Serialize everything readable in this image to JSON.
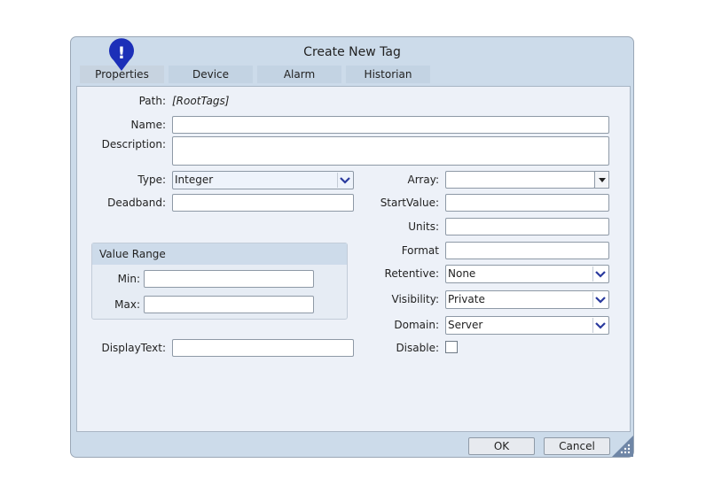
{
  "window": {
    "title": "Create New Tag"
  },
  "tabs": [
    "Properties",
    "Device",
    "Alarm",
    "Historian"
  ],
  "fields": {
    "path_label": "Path:",
    "path_value": "[RootTags]",
    "name_label": "Name:",
    "name_value": "",
    "description_label": "Description:",
    "description_value": "",
    "type_label": "Type:",
    "type_value": "Integer",
    "deadband_label": "Deadband:",
    "deadband_value": "",
    "array_label": "Array:",
    "array_value": "",
    "startvalue_label": "StartValue:",
    "startvalue_value": "",
    "units_label": "Units:",
    "units_value": "",
    "format_label": "Format",
    "format_value": "",
    "retentive_label": "Retentive:",
    "retentive_value": "None",
    "visibility_label": "Visibility:",
    "visibility_value": "Private",
    "domain_label": "Domain:",
    "domain_value": "Server",
    "disable_label": "Disable:",
    "disable_checked": false,
    "displaytext_label": "DisplayText:",
    "displaytext_value": ""
  },
  "value_range": {
    "title": "Value Range",
    "min_label": "Min:",
    "min_value": "",
    "max_label": "Max:",
    "max_value": ""
  },
  "buttons": {
    "ok": "OK",
    "cancel": "Cancel"
  },
  "alert": {
    "glyph": "!"
  },
  "colors": {
    "accent": "#1c2fb8",
    "dialog_bg": "#ccdbea",
    "panel_bg": "#edf1f8"
  },
  "icons": [
    "alert-pin-icon",
    "chevron-down-icon",
    "resize-grip-icon"
  ]
}
